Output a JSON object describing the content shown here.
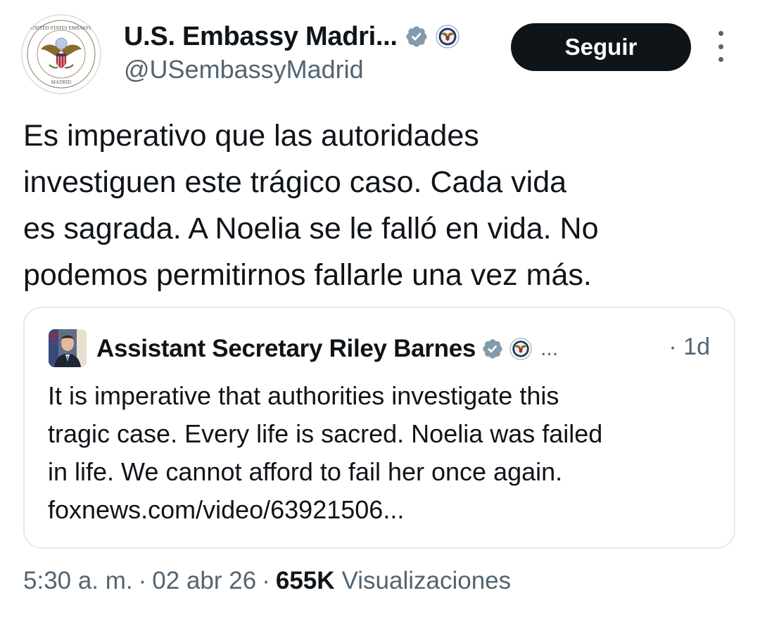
{
  "header": {
    "display_name": "U.S. Embassy Madri...",
    "handle": "@USembassyMadrid",
    "avatar_seal_top_text": "UNITED STATES EMBASSY",
    "avatar_seal_bottom_text": "MADRID",
    "follow_label": "Seguir"
  },
  "tweet": {
    "lines": [
      "Es imperativo que las autoridades",
      "investiguen este trágico caso. Cada vida",
      "es sagrada. A Noelia se le falló en vida. No",
      "podemos permitirnos fallarle una vez más."
    ]
  },
  "quote": {
    "display_name": "Assistant Secretary Riley Barnes",
    "ellipsis": "...",
    "time_separator": "·",
    "time": "1d",
    "lines": [
      "It is imperative that authorities investigate this",
      "tragic case. Every life is sacred. Noelia was failed",
      "in life. We cannot afford to fail her once again.",
      "foxnews.com/video/63921506..."
    ]
  },
  "meta": {
    "time": "5:30 a. m.",
    "separator": "·",
    "date": "02 abr 26",
    "views_count": "655K",
    "views_label": "Visualizaciones"
  },
  "colors": {
    "text_primary": "#0f1419",
    "text_secondary": "#536471",
    "verified_badge": "#829aab",
    "follow_button_bg": "#0f1419",
    "card_border": "#e6e9ec"
  },
  "icons": {
    "verified": "verified-badge-icon",
    "affiliation": "state-department-seal-icon",
    "more": "more-options-icon"
  }
}
